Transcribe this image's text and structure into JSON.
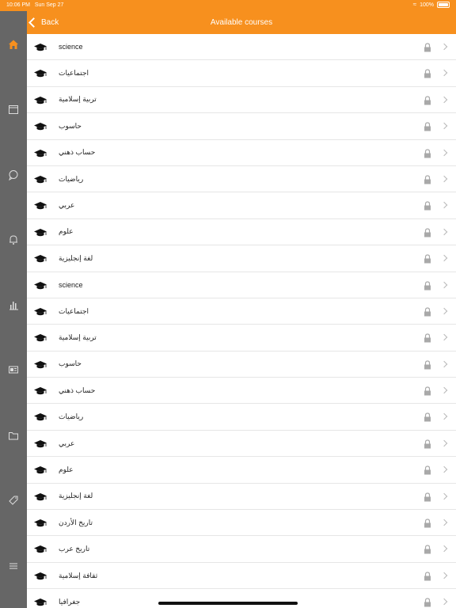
{
  "status": {
    "time": "10:06 PM",
    "date": "Sun Sep 27",
    "battery": "100%"
  },
  "nav": {
    "back_label": "Back",
    "title": "Available courses"
  },
  "sidebar": {
    "items": [
      "home-icon",
      "calendar-icon",
      "chat-icon",
      "bell-icon",
      "stats-icon",
      "news-icon",
      "folder-icon",
      "tag-icon",
      "menu-icon"
    ]
  },
  "courses": [
    "science",
    "اجتماعيات",
    "تربية إسلامية",
    "حاسوب",
    "حساب ذهني",
    "رياضيات",
    "عربي",
    "علوم",
    "لغة إنجليزية",
    "science",
    "اجتماعيات",
    "تربية إسلامية",
    "حاسوب",
    "حساب ذهني",
    "رياضيات",
    "عربي",
    "علوم",
    "لغة إنجليزية",
    "تاريخ الأردن",
    "تاريخ عرب",
    "ثقافة إسلامية",
    "جغرافيا"
  ],
  "colors": {
    "accent": "#f7901e",
    "sidebar": "#666666"
  }
}
